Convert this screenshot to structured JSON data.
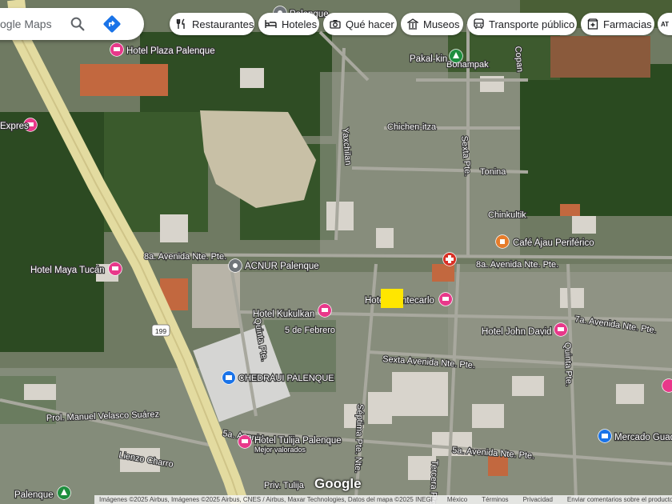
{
  "search": {
    "placeholder": "ogle Maps"
  },
  "chips": [
    {
      "label": "Restaurantes",
      "icon": "fork-knife-icon"
    },
    {
      "label": "Hoteles",
      "icon": "bed-icon"
    },
    {
      "label": "Qué hacer",
      "icon": "camera-icon"
    },
    {
      "label": "Museos",
      "icon": "museum-icon"
    },
    {
      "label": "Transporte público",
      "icon": "bus-icon"
    },
    {
      "label": "Farmacias",
      "icon": "pharmacy-icon"
    },
    {
      "label": "AT",
      "icon": "atm-icon"
    }
  ],
  "places": {
    "hotel_plaza": "Hotel Plaza Palenque",
    "expres": "Expres",
    "maya_tucan": "Hotel Maya Tucán",
    "acnur": "ACNUR Palenque",
    "kukulkan": "Hotel Kukulkan",
    "chedraui": "CHEDRAUI PALENQUE",
    "tulija": "Hotel Tulija Palenque",
    "tulija_sub": "Mejor valorados",
    "montecarlo": "Hotel Montecarlo",
    "john_david": "Hotel John David",
    "cafe_ajau": "Café Ajau Periférico",
    "pakal_kin": "Pakal-kin",
    "mercado": "Mercado Guad",
    "palenque_bl": "Palenque",
    "top_center": "Palenque"
  },
  "streets": {
    "av8": "8a. Avenida Nte. Pte.",
    "av8b": "8a. Avenida Nte. Pte.",
    "av7": "7a. Avenida Nte. Pte.",
    "av6": "Sexta Avenida Nte. Pte.",
    "av5": "5a. Avenida Nte. Pte.",
    "av5b": "5a. Avenida",
    "feb5": "5 de Febrero",
    "quinta": "Quinta Pte.",
    "quinta2": "Quinta Pte.",
    "septima": "Séptima Pte. Nte.",
    "sexta_pte": "Sexta Pte.",
    "tercera": "Tercera Pte.",
    "velasco": "Prol. Manuel Velasco Suárez",
    "lienzo": "Lienzo Charro",
    "priv_tulija": "Priv. Tulija",
    "bonampak": "Bonampak",
    "chichen": "Chichen-itza",
    "tonina": "Tonina",
    "chinkultik": "Chinkultik",
    "yaxchilan": "Yaxchilan",
    "copan": "Copan",
    "hwy": "199"
  },
  "footer": {
    "attribution": "Imágenes ©2025 Airbus, Imágenes ©2025 Airbus, CNES / Airbus, Maxar Technologies, Datos del mapa ©2025 INEGI",
    "country": "México",
    "terms": "Términos",
    "privacy": "Privacidad",
    "feedback": "Enviar comentarios sobre el producto"
  },
  "logo": "Google",
  "colors": {
    "pin_pink": "#e8388a",
    "pin_blue": "#1a73e8",
    "pin_orange": "#e67c2b",
    "pin_green": "#1e8e3e",
    "pin_gray": "#70757a",
    "pin_red": "#d93025",
    "marker_yellow": "#ffe600"
  }
}
